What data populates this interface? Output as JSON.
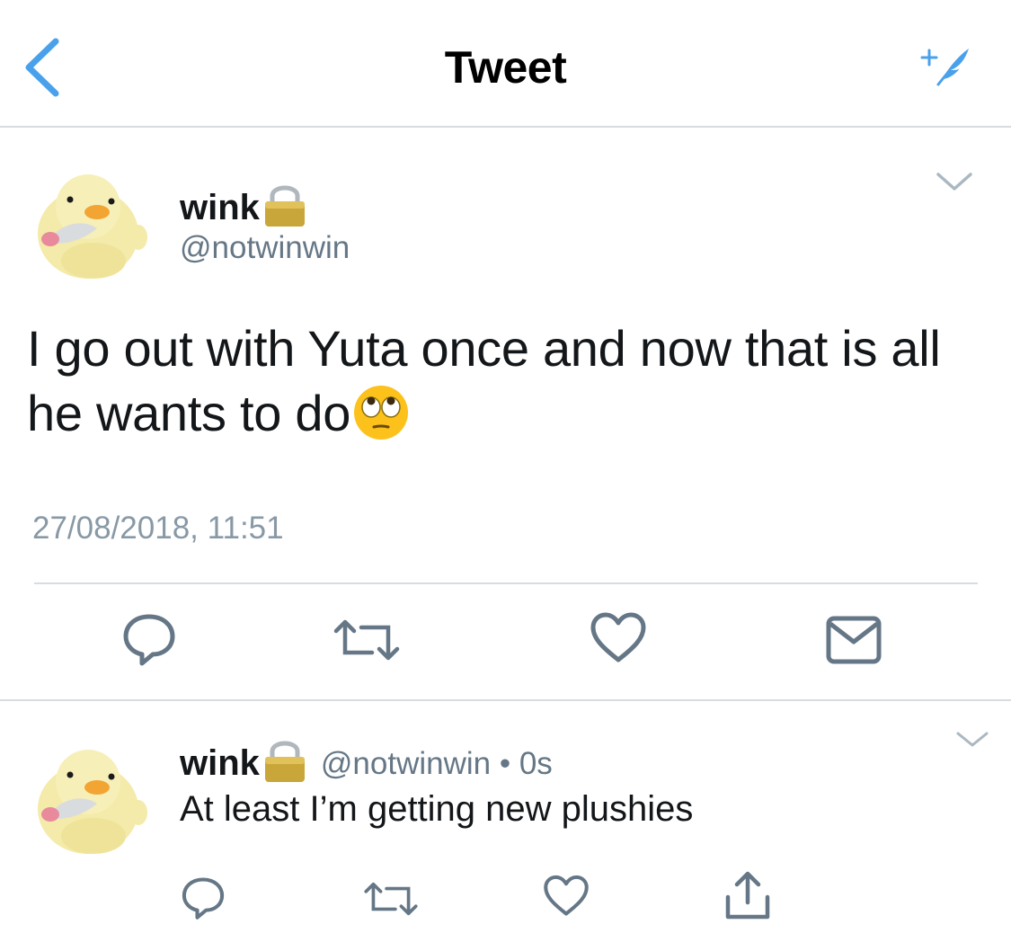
{
  "header": {
    "title": "Tweet",
    "back_icon": "chevron-left-icon",
    "compose_icon": "compose-feather-icon"
  },
  "main_tweet": {
    "display_name": "wink",
    "handle": "@notwinwin",
    "text": "I go out with Yuta once and now that is all he wants to do",
    "text_emoji": "face-with-rolling-eyes-emoji",
    "timestamp": "27/08/2018, 11:51",
    "actions": [
      "reply-icon",
      "retweet-icon",
      "like-icon",
      "direct-message-icon"
    ]
  },
  "reply_tweet": {
    "display_name": "wink",
    "meta": "@notwinwin • 0s",
    "text": "At least I’m getting new plushies",
    "actions": [
      "reply-icon",
      "retweet-icon",
      "like-icon",
      "share-icon"
    ]
  },
  "colors": {
    "accent": "#4aa1eb",
    "text": "#14171a",
    "secondary": "#657786",
    "divider": "#d7dce0",
    "icon": "#657786"
  }
}
